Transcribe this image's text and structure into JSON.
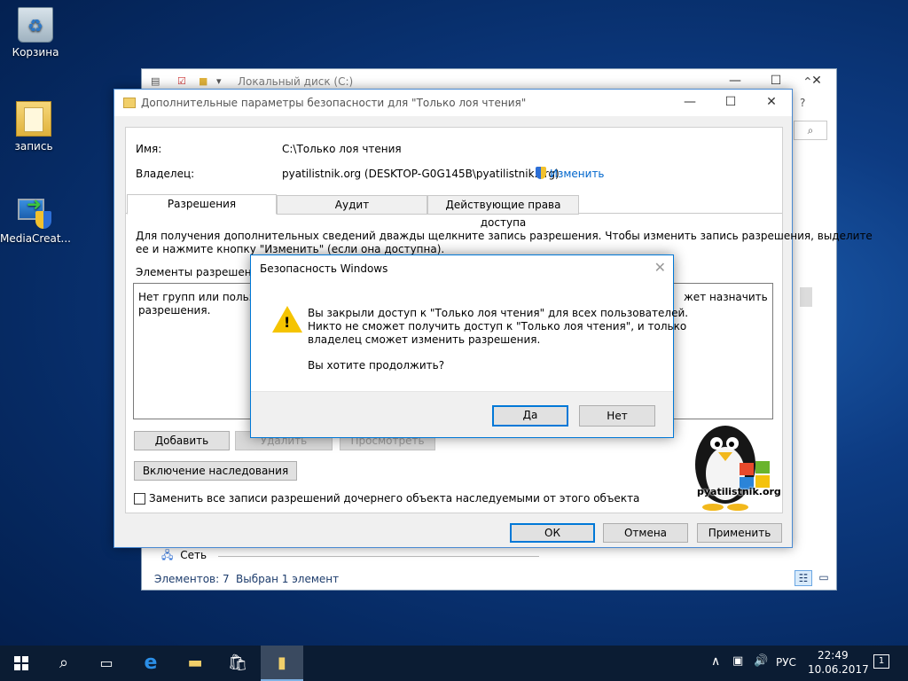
{
  "desktop": {
    "icons": [
      {
        "label": "Корзина",
        "icon": "recycle-bin-icon"
      },
      {
        "label": "запись",
        "icon": "document-folder-icon"
      },
      {
        "label": "MediaCreat...",
        "icon": "media-creation-tool-icon"
      }
    ]
  },
  "explorer": {
    "title": "Локальный диск (C:)",
    "nav_item": "Сеть",
    "status_count": "Элементов: 7",
    "status_selected": "Выбран 1 элемент"
  },
  "advanced": {
    "title": "Дополнительные параметры безопасности  для \"Только лоя чтения\"",
    "name_label": "Имя:",
    "name_value": "C:\\Только лоя чтения",
    "owner_label": "Владелец:",
    "owner_value": "pyatilistnik.org (DESKTOP-G0G145B\\pyatilistnik.org)",
    "change_link": "Изменить",
    "tabs": [
      {
        "label": "Разрешения",
        "active": true
      },
      {
        "label": "Аудит",
        "active": false
      },
      {
        "label": "Действующие права доступа",
        "active": false
      }
    ],
    "info_line1": "Для получения дополнительных сведений дважды щелкните запись разрешения. Чтобы изменить запись разрешения, выделите",
    "info_line2": "ее и нажмите кнопку \"Изменить\" (если она доступна).",
    "entries_label": "Элементы разрешений:",
    "list_line1_left": "Нет групп или пользов",
    "list_line1_right": "жет назначить",
    "list_line2": "разрешения.",
    "add_button": "Добавить",
    "remove_button": "Удалить",
    "view_button": "Просмотреть",
    "inherit_button": "Включение наследования",
    "replace_checkbox": "Заменить все записи разрешений дочернего объекта наследуемыми от этого объекта",
    "ok_button": "ОК",
    "cancel_button": "Отмена",
    "apply_button": "Применить"
  },
  "logo": {
    "text": "pyatilistnik.org"
  },
  "dialog": {
    "title": "Безопасность Windows",
    "line1": "Вы закрыли доступ к \"Только лоя чтения\" для всех пользователей.",
    "line2": "Никто не сможет получить доступ к \"Только лоя чтения\", и только",
    "line3": "владелец сможет изменить разрешения.",
    "question": "Вы хотите продолжить?",
    "yes_button": "Да",
    "no_button": "Нет"
  },
  "taskbar": {
    "language": "РУС",
    "time": "22:49",
    "date": "10.06.2017",
    "notification_count": "1"
  },
  "colors": {
    "accent": "#0078d7",
    "warning": "#f5c400",
    "taskbar": "#0b1c33"
  }
}
